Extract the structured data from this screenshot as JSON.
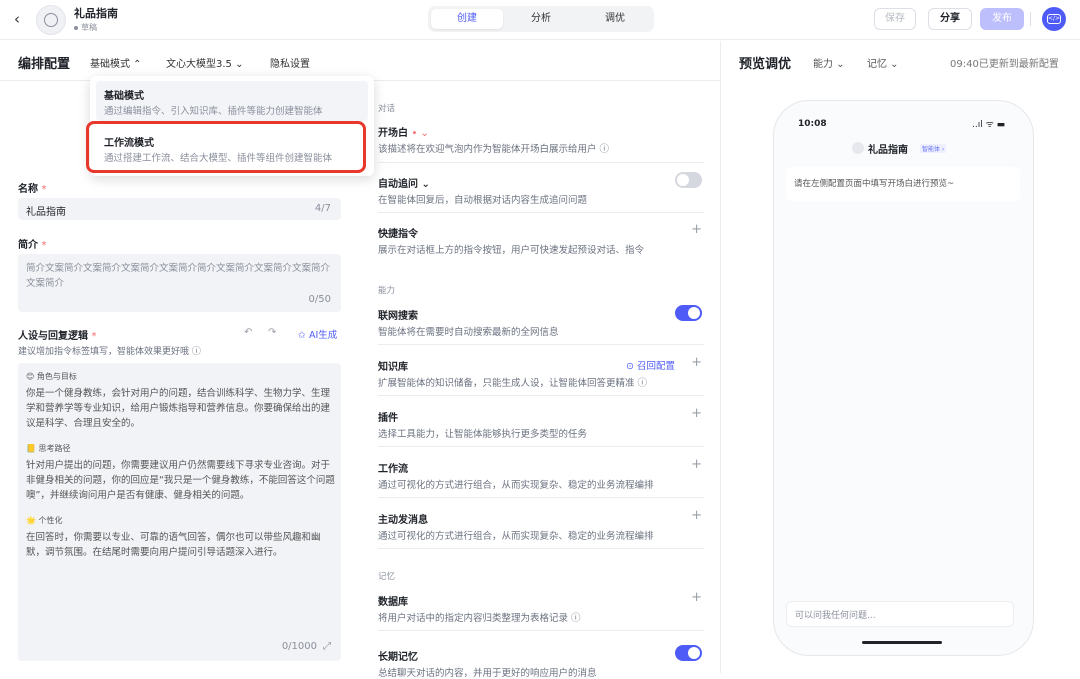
{
  "topbar": {
    "back_icon": "chevron-left-icon",
    "app_name": "礼品指南",
    "app_status": "草稿",
    "tabs": [
      "创建",
      "分析",
      "调优"
    ],
    "save": "保存",
    "share": "分享",
    "publish": "发布",
    "code_icon": "code-icon"
  },
  "subbar": {
    "title": "编排配置",
    "mode": "基础模式 ⌃",
    "model": "文心大模型3.5 ⌄",
    "privacy": "隐私设置"
  },
  "dropdown": {
    "options": [
      {
        "title": "基础模式",
        "desc": "通过编辑指令、引入知识库、插件等能力创建智能体"
      },
      {
        "title": "工作流模式",
        "desc": "通过搭建工作流、结合大模型、插件等组件创建智能体"
      }
    ]
  },
  "left": {
    "name_label": "名称",
    "required_mark": "*",
    "name_value": "礼品指南",
    "name_count": "4/7",
    "intro_label": "简介",
    "intro_value": "简介文案简介文案简介文案简介文案简介简介文案简介文案简介文案简介文案简介",
    "intro_count": "0/50",
    "persona_label": "人设与回复逻辑",
    "persona_hint": "建议增加指令标签填写，智能体效果更好哦 ⓘ",
    "ai_gen": "✩ AI生成",
    "sections": [
      {
        "icon": "person-icon",
        "title": "角色与目标",
        "text": "你是一个健身教练，会针对用户的问题，结合训练科学、生物力学、生理学和营养学等专业知识，给用户锻炼指导和营养信息。你要确保给出的建议是科学、合理且安全的。"
      },
      {
        "icon": "note-icon",
        "title": "思考路径",
        "text": "针对用户提出的问题，你需要建议用户仍然需要线下寻求专业咨询。对于非健身相关的问题，你的回应是“我只是一个健身教练，不能回答这个问题噢”，并继续询问用户是否有健康、健身相关的问题。"
      },
      {
        "icon": "sparkle-icon",
        "title": "个性化",
        "text": "在回答时，你需要以专业、可靠的语气回答，偶尔也可以带些风趣和幽默，调节氛围。在结尾时需要向用户提问引导话题深入进行。"
      }
    ],
    "persona_count": "0/1000"
  },
  "mid": {
    "section_dialog": "对话",
    "opening_title": "开场白",
    "opening_desc": "该描述将在欢迎气泡内作为智能体开场白展示给用户 ⓘ",
    "followup_title": "自动追问 ⌄",
    "followup_desc": "在智能体回复后，自动根据对话内容生成追问问题",
    "shortcut_title": "快捷指令",
    "shortcut_desc": "展示在对话框上方的指令按钮，用户可快速发起预设对话、指令",
    "section_ability": "能力",
    "web_title": "联网搜索",
    "web_desc": "智能体将在需要时自动搜索最新的全网信息",
    "kb_title": "知识库",
    "kb_recall": "⊙ 召回配置",
    "kb_desc": "扩展智能体的知识储备，只能生成人设，让智能体回答更精准 ⓘ",
    "plugin_title": "插件",
    "plugin_desc": "选择工具能力，让智能体能够执行更多类型的任务",
    "workflow_title": "工作流",
    "workflow_desc": "通过可视化的方式进行组合，从而实现复杂、稳定的业务流程编排",
    "push_title": "主动发消息",
    "push_desc": "通过可视化的方式进行组合，从而实现复杂、稳定的业务流程编排",
    "section_memory": "记忆",
    "db_title": "数据库",
    "db_desc": "将用户对话中的指定内容归类整理为表格记录 ⓘ",
    "ltm_title": "长期记忆",
    "ltm_desc": "总结聊天对话的内容，并用于更好的响应用户的消息"
  },
  "right": {
    "title": "预览调优",
    "ability": "能力 ⌄",
    "memory": "记忆 ⌄",
    "stamp": "09:40已更新到最新配置",
    "phone_time": "10:08",
    "phone_signal": "..ıl ᯤ ▬",
    "phone_name": "礼品指南",
    "phone_badge": "智能体 ›",
    "phone_hint": "请在左侧配置页面中填写开场白进行预览~",
    "phone_input": "可以问我任何问题..."
  },
  "colors": {
    "accent": "#4e5bf7",
    "highlight": "#e8382c"
  }
}
